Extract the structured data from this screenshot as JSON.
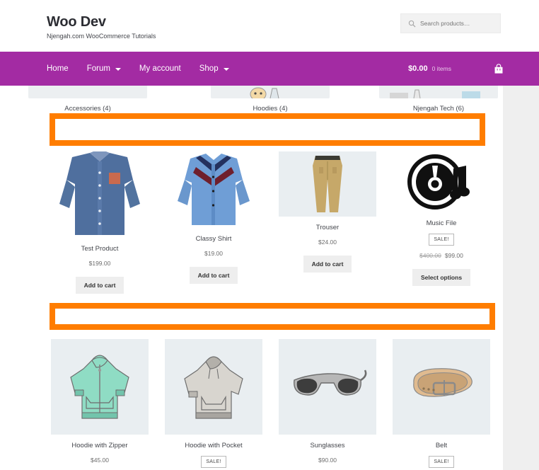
{
  "header": {
    "title": "Woo Dev",
    "tagline": "Njengah.com WooCommerce Tutorials",
    "search": {
      "placeholder": "Search products…",
      "value": "",
      "icon": "search-icon"
    }
  },
  "nav": {
    "items": [
      {
        "label": "Home",
        "has_dropdown": false
      },
      {
        "label": "Forum",
        "has_dropdown": true
      },
      {
        "label": "My account",
        "has_dropdown": false
      },
      {
        "label": "Shop",
        "has_dropdown": true
      }
    ],
    "cart": {
      "total": "$0.00",
      "count": "0 items",
      "icon": "shopping-basket-icon"
    }
  },
  "categories": [
    {
      "label": "Accessories (4)"
    },
    {
      "label": "Hoodies (4)"
    },
    {
      "label": "Njengah Tech (6)"
    }
  ],
  "products_row_1": [
    {
      "title": "Test Product",
      "price": "$199.00",
      "regular_price": "",
      "on_sale": false,
      "sale_label": "",
      "button": "Add to cart",
      "image": "blue-dress-shirt-photo"
    },
    {
      "title": "Classy Shirt",
      "price": "$19.00",
      "regular_price": "",
      "on_sale": false,
      "sale_label": "",
      "button": "Add to cart",
      "image": "chevron-panel-shirt-photo"
    },
    {
      "title": "Trouser",
      "price": "$24.00",
      "regular_price": "",
      "on_sale": false,
      "sale_label": "",
      "button": "Add to cart",
      "image": "khaki-trousers-photo"
    },
    {
      "title": "Music File",
      "price": "$99.00",
      "regular_price": "$400.00",
      "on_sale": true,
      "sale_label": "SALE!",
      "button": "Select options",
      "image": "vinyl-record-music-note-icon"
    }
  ],
  "products_row_2": [
    {
      "title": "Hoodie with Zipper",
      "price": "$45.00",
      "regular_price": "",
      "on_sale": false,
      "sale_label": "",
      "button": "",
      "image": "mint-zip-hoodie-sketch"
    },
    {
      "title": "Hoodie with Pocket",
      "price": "",
      "regular_price": "",
      "on_sale": true,
      "sale_label": "SALE!",
      "button": "",
      "image": "gray-pocket-hoodie-sketch"
    },
    {
      "title": "Sunglasses",
      "price": "$90.00",
      "regular_price": "",
      "on_sale": false,
      "sale_label": "",
      "button": "",
      "image": "sunglasses-sketch"
    },
    {
      "title": "Belt",
      "price": "",
      "regular_price": "",
      "on_sale": true,
      "sale_label": "SALE!",
      "button": "",
      "image": "leather-belt-sketch"
    }
  ],
  "annotations": [
    {
      "name": "highlight-box-top",
      "color": "#ff7d00"
    },
    {
      "name": "highlight-box-bottom",
      "color": "#ff7d00"
    }
  ],
  "colors": {
    "nav_purple": "#a32ba3",
    "highlight_orange": "#ff7d00",
    "page_background": "#efefef",
    "content_background": "#ffffff",
    "product_tile": "#e9eef1"
  }
}
